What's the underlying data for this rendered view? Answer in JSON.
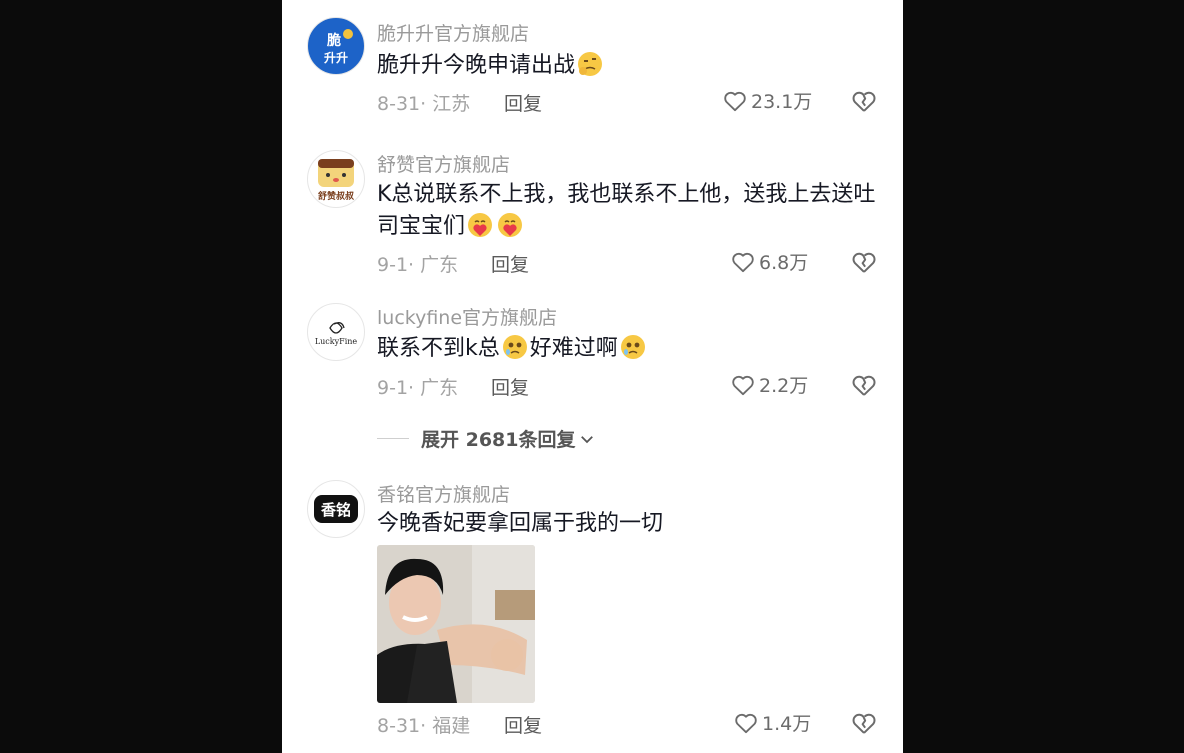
{
  "comments": [
    {
      "name": "脆升升官方旗舰店",
      "text": "脆升升今晚申请出战",
      "date": "8-31·",
      "location": "江苏",
      "reply": "回复",
      "likes": "23.1万",
      "avatar_text": "脆升升"
    },
    {
      "name": "舒赞官方旗舰店",
      "text": "K总说联系不上我，我也联系不上他，送我上去送吐司宝宝们",
      "date": "9-1·",
      "location": "广东",
      "reply": "回复",
      "likes": "6.8万",
      "avatar_text": "舒赞叔叔"
    },
    {
      "name": "luckyfine官方旗舰店",
      "text_a": "联系不到k总",
      "text_b": "好难过啊",
      "date": "9-1·",
      "location": "广东",
      "reply": "回复",
      "likes": "2.2万",
      "avatar_text": "LuckyFine"
    },
    {
      "name": "香铭官方旗舰店",
      "text": "今晚香妃要拿回属于我的一切",
      "date": "8-31·",
      "location": "福建",
      "reply": "回复",
      "likes": "1.4万",
      "avatar_text": "香铭"
    }
  ],
  "expand_replies": "展开 2681条回复",
  "icons": {
    "like": "heart-outline-icon",
    "dislike": "broken-heart-icon",
    "expand": "chevron-down-icon"
  },
  "colors": {
    "text": "#161823",
    "muted": "#9a9a9a",
    "background": "#ffffff"
  }
}
